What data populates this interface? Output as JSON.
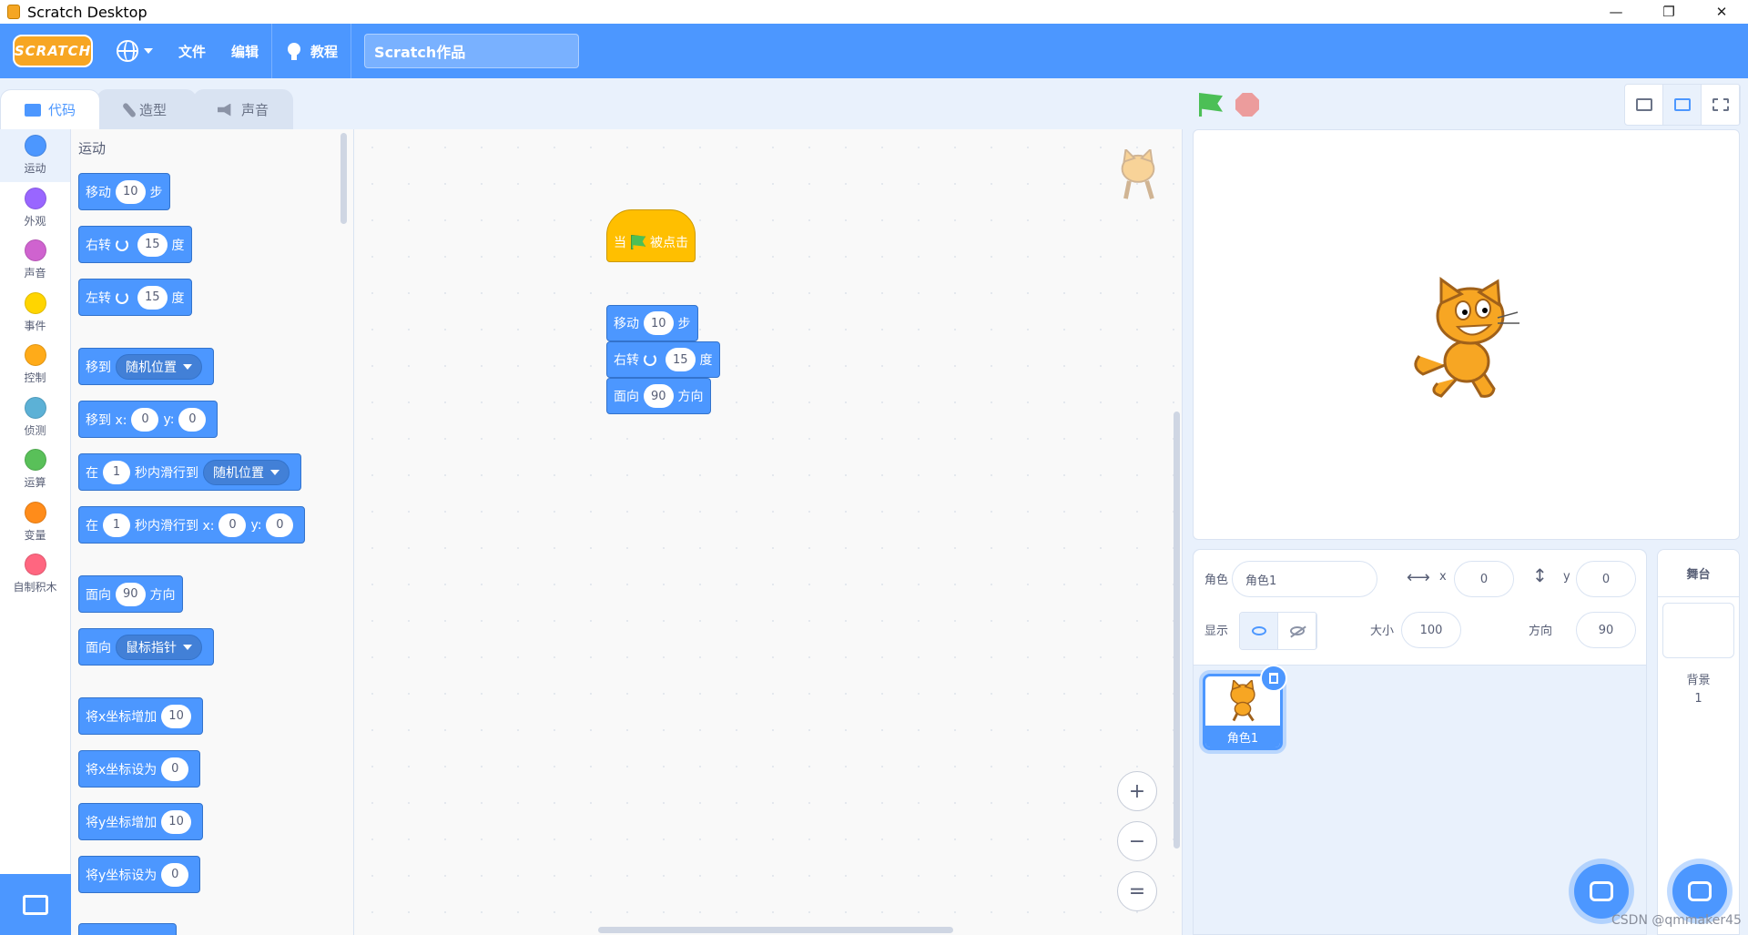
{
  "window": {
    "title": "Scratch Desktop",
    "controls": [
      "—",
      "❐",
      "✕"
    ]
  },
  "menubar": {
    "logo": "SCRATCH",
    "file": "文件",
    "edit": "编辑",
    "tutorials": "教程",
    "project_title": "Scratch作品",
    "color": "#4c97ff"
  },
  "tabs": [
    {
      "label": "代码",
      "icon": "code-icon",
      "active": true
    },
    {
      "label": "造型",
      "icon": "brush-icon",
      "active": false
    },
    {
      "label": "声音",
      "icon": "speaker-icon",
      "active": false
    }
  ],
  "categories": [
    {
      "label": "运动",
      "color": "#4c97ff",
      "active": true
    },
    {
      "label": "外观",
      "color": "#9966ff"
    },
    {
      "label": "声音",
      "color": "#cf63cf"
    },
    {
      "label": "事件",
      "color": "#ffd500"
    },
    {
      "label": "控制",
      "color": "#ffab19"
    },
    {
      "label": "侦测",
      "color": "#5cb1d6"
    },
    {
      "label": "运算",
      "color": "#59c059"
    },
    {
      "label": "变量",
      "color": "#ff8c1a"
    },
    {
      "label": "自制积木",
      "color": "#ff6680"
    }
  ],
  "palette": {
    "title": "运动",
    "blocks": {
      "move": {
        "a": "移动",
        "v": "10",
        "b": "步"
      },
      "turn_right": {
        "a": "右转",
        "v": "15",
        "b": "度"
      },
      "turn_left": {
        "a": "左转",
        "v": "15",
        "b": "度"
      },
      "goto": {
        "a": "移到",
        "dd": "随机位置"
      },
      "goto_xy": {
        "a": "移到 x:",
        "x": "0",
        "ylbl": "y:",
        "y": "0"
      },
      "glide": {
        "a": "在",
        "v": "1",
        "b": "秒内滑行到",
        "dd": "随机位置"
      },
      "glide_xy": {
        "a": "在",
        "v": "1",
        "b": "秒内滑行到 x:",
        "x": "0",
        "ylbl": "y:",
        "y": "0"
      },
      "point_dir": {
        "a": "面向",
        "v": "90",
        "b": "方向"
      },
      "point_to": {
        "a": "面向",
        "dd": "鼠标指针"
      },
      "change_x": {
        "a": "将x坐标增加",
        "v": "10"
      },
      "set_x": {
        "a": "将x坐标设为",
        "v": "0"
      },
      "change_y": {
        "a": "将y坐标增加",
        "v": "10"
      },
      "set_y": {
        "a": "将y坐标设为",
        "v": "0"
      }
    }
  },
  "script": {
    "hat": {
      "a": "当",
      "b": "被点击"
    },
    "move": {
      "a": "移动",
      "v": "10",
      "b": "步"
    },
    "turn": {
      "a": "右转",
      "v": "15",
      "b": "度"
    },
    "point": {
      "a": "面向",
      "v": "90",
      "b": "方向"
    }
  },
  "zoom": {
    "in": "+",
    "out": "−",
    "reset": "="
  },
  "sprite_info": {
    "sprite_label": "角色",
    "sprite_name": "角色1",
    "x_label": "x",
    "x": "0",
    "y_label": "y",
    "y": "0",
    "show_label": "显示",
    "size_label": "大小",
    "size": "100",
    "direction_label": "方向",
    "direction": "90"
  },
  "sprites": [
    {
      "name": "角色1",
      "selected": true
    }
  ],
  "stage_pane": {
    "title": "舞台",
    "backdrops_label": "背景",
    "backdrops_count": "1"
  },
  "watermark": "CSDN @qmmaker45"
}
